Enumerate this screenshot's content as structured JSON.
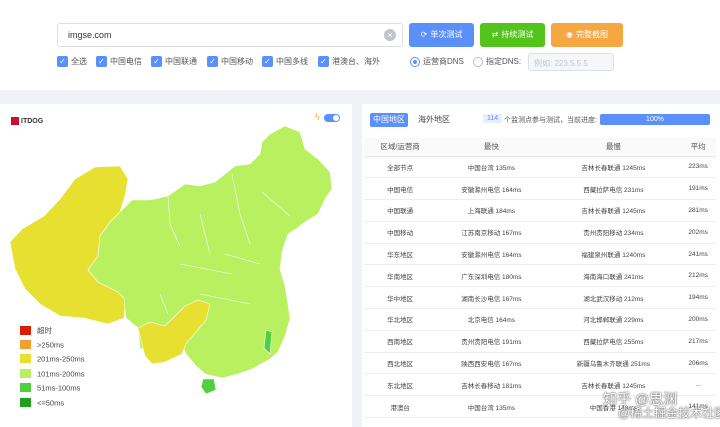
{
  "search": {
    "value": "imgse.com",
    "clear_icon": "clear-icon"
  },
  "buttons": {
    "single": "单次测试",
    "continuous": "持续测试",
    "screenshot": "完整截图"
  },
  "checkboxes": [
    "全选",
    "中国电信",
    "中国联通",
    "中国移动",
    "中国多线",
    "港澳台、海外"
  ],
  "dns": {
    "operator": "运营商DNS",
    "custom": "指定DNS:",
    "placeholder": "例如: 223.5.5.5"
  },
  "map": {
    "logo": "ITDOG",
    "legend": [
      {
        "label": "超时",
        "color": "#d81e06"
      },
      {
        "label": ">250ms",
        "color": "#f0a030"
      },
      {
        "label": "201ms-250ms",
        "color": "#e8e030"
      },
      {
        "label": "101ms-200ms",
        "color": "#b8f060"
      },
      {
        "label": "51ms-100ms",
        "color": "#50d040"
      },
      {
        "label": "<=50ms",
        "color": "#20a020"
      }
    ]
  },
  "tabs": {
    "china": "中国地区",
    "overseas": "海外地区"
  },
  "progress": {
    "count": "114",
    "text": "个监测点参与测试，当前进度:",
    "percent": "100%",
    "value": 1.0
  },
  "table": {
    "headers": [
      "区域/运营商",
      "最快",
      "最慢",
      "平均"
    ],
    "rows": [
      [
        "全部节点",
        "中国台湾 135ms",
        "吉林长春联通 1245ms",
        "223ms"
      ],
      [
        "中国电信",
        "安徽滁州电信 164ms",
        "西藏拉萨电信 231ms",
        "191ms"
      ],
      [
        "中国联通",
        "上海联通 184ms",
        "吉林长春联通 1245ms",
        "281ms"
      ],
      [
        "中国移动",
        "江苏南京移动 167ms",
        "贵州贵阳移动 234ms",
        "202ms"
      ],
      [
        "华东地区",
        "安徽滁州电信 164ms",
        "福建泉州联通 1240ms",
        "241ms"
      ],
      [
        "华南地区",
        "广东深圳电信 180ms",
        "海南海口联通 241ms",
        "212ms"
      ],
      [
        "华中地区",
        "湖南长沙电信 167ms",
        "湖北武汉移动 212ms",
        "194ms"
      ],
      [
        "华北地区",
        "北京电信 164ms",
        "河北邯郸联通 229ms",
        "200ms"
      ],
      [
        "西南地区",
        "贵州贵阳电信 191ms",
        "西藏拉萨电信 255ms",
        "217ms"
      ],
      [
        "西北地区",
        "陕西西安电信 167ms",
        "新疆乌鲁木齐联通 251ms",
        "206ms"
      ],
      [
        "东北地区",
        "吉林长春移动 181ms",
        "吉林长春联通 1245ms",
        "..."
      ],
      [
        "港澳台",
        "中国台湾 135ms",
        "中国香港 148ms",
        "141ms"
      ]
    ]
  },
  "watermark": {
    "line1": "知乎 @思渊",
    "line2": "@稀土掘金技术社区"
  }
}
